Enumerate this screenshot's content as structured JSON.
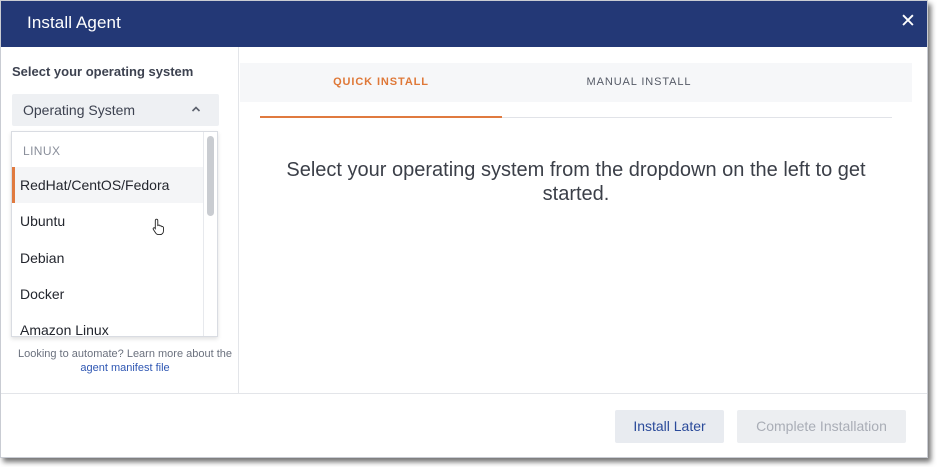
{
  "dialog": {
    "title": "Install Agent",
    "close_icon": "close-icon",
    "close_glyph": "✕"
  },
  "sidebar": {
    "label": "Select your operating system",
    "select": {
      "value": "Operating System",
      "icon": "chevron-up-icon"
    },
    "dropdown": {
      "group": "LINUX",
      "options": [
        {
          "label": "RedHat/CentOS/Fedora",
          "highlighted": true
        },
        {
          "label": "Ubuntu"
        },
        {
          "label": "Debian"
        },
        {
          "label": "Docker"
        },
        {
          "label": "Amazon Linux"
        }
      ]
    },
    "automate_text": "Looking to automate? Learn more about the",
    "automate_link": "agent manifest file"
  },
  "tabs": [
    {
      "label": "QUICK INSTALL",
      "active": true
    },
    {
      "label": "MANUAL INSTALL",
      "active": false
    }
  ],
  "main": {
    "message": "Select your operating system from the dropdown on the left to get started."
  },
  "footer": {
    "install_later": "Install Later",
    "complete": "Complete Installation"
  },
  "colors": {
    "header_bg": "#233876",
    "accent": "#e07a3f",
    "link": "#2f57b3"
  }
}
